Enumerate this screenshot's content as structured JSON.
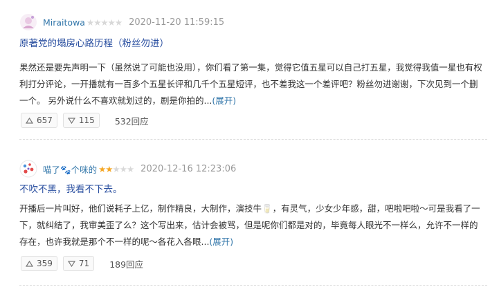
{
  "reviews": [
    {
      "username": "Miraitowa",
      "stars": [
        false,
        false,
        false,
        false,
        false
      ],
      "time": "2020-11-20 11:59:15",
      "title": "原著党的塌房心路历程（粉丝勿进）",
      "body": "果然还是要先声明一下（虽然说了可能也没用），你们看了第一集，觉得它值五星可以自己打五星，我觉得我值一星也有权利打分评论，一开播就有一百多个五星长评和几千个五星短评，也不差我这一个差评吧？粉丝勿进谢谢，下次见到一个删一个。 另外说什么不喜欢就划过的，剧是你拍的...",
      "expand": "(展开)",
      "upvotes": "657",
      "downvotes": "115",
      "replies": "532回应"
    },
    {
      "username": "喵了🐾个咪的",
      "stars": [
        true,
        true,
        false,
        false,
        false
      ],
      "time": "2020-12-16 12:23:06",
      "title": "不吹不黑，我看不下去。",
      "body": "开播后一片叫好，他们说耗子上亿，制作精良，大制作，演技牛🥛，有灵气，少女少年感，甜，吧啦吧啦～可是我看了一下，就纠结了，我审美歪了么？这个写出来，估计会被骂，但是呢你们都是对的，毕竟每人眼光不一样么，允许不一样的存在，也许我就是那个不一样的呢～各花入各眼...",
      "expand": "(展开)",
      "upvotes": "359",
      "downvotes": "71",
      "replies": "189回应"
    }
  ],
  "colors": {
    "link": "#3377aa",
    "title": "#2a4fa0",
    "star_on": "#f5a623",
    "star_off": "#d8d8d8",
    "meta": "#999999"
  },
  "icons": {
    "up": "triangle-up-icon",
    "down": "triangle-down-icon",
    "avatar": "avatar-image"
  }
}
